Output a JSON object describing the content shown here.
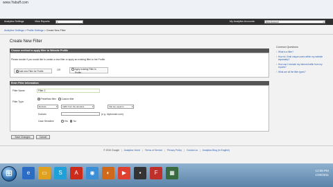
{
  "browser": {
    "watermark": "www.Yabuff.com"
  },
  "ga_bar": {
    "analytics_settings": "Analytics Settings",
    "view_reports": "View Reports:",
    "my_analytics_accounts": "My Analytics Accounts:",
    "selected_account": "New Account"
  },
  "breadcrumb": {
    "items": [
      "Analytics Settings",
      "Profile Settings",
      "Create New Filter"
    ],
    "separator": ">"
  },
  "page": {
    "title": "Create New Filter",
    "section1_title": "Choose method to apply filter to Website Profile",
    "section1_desc": "Please decide if you would like to create a new filter or apply an existing filter to the Profile.",
    "option_new": "Add new Filter for Profile",
    "or_label": "OR",
    "option_existing_line1": "Apply existing Filter to",
    "option_existing_line2": "Profile",
    "section2_title": "Enter Filter Information",
    "filter_name_label": "Filter Name:",
    "filter_name_value": "Filter 2",
    "filter_type_label": "Filter Type:",
    "predefined_label": "Predefined filter",
    "custom_label": "Custom filter",
    "select_exclude": "Exclude",
    "select_traffic": "traffic from the domains",
    "select_equal": "that are equal to",
    "domain_label": "Domain",
    "domain_hint": "(e.g. mydomain.com)",
    "case_sensitive_label": "Case Sensitive",
    "yes_label": "Yes",
    "no_label": "No",
    "save_button": "Save Changes",
    "cancel_button": "Cancel"
  },
  "help": {
    "title": "Common Questions",
    "items": [
      "What is a filter?",
      "How do I limit unique users within my website separately?",
      "How can I exclude my internal traffic from my reports?",
      "What are all the filter types?"
    ]
  },
  "footer": {
    "copyright": "© 2010 Google",
    "links": [
      "Analytics Home",
      "Terms of Service",
      "Privacy Policy",
      "Contact us",
      "Analytics Blog (in English)"
    ]
  },
  "taskbar": {
    "time": "12:08 PM",
    "date": "1/30/2011"
  }
}
